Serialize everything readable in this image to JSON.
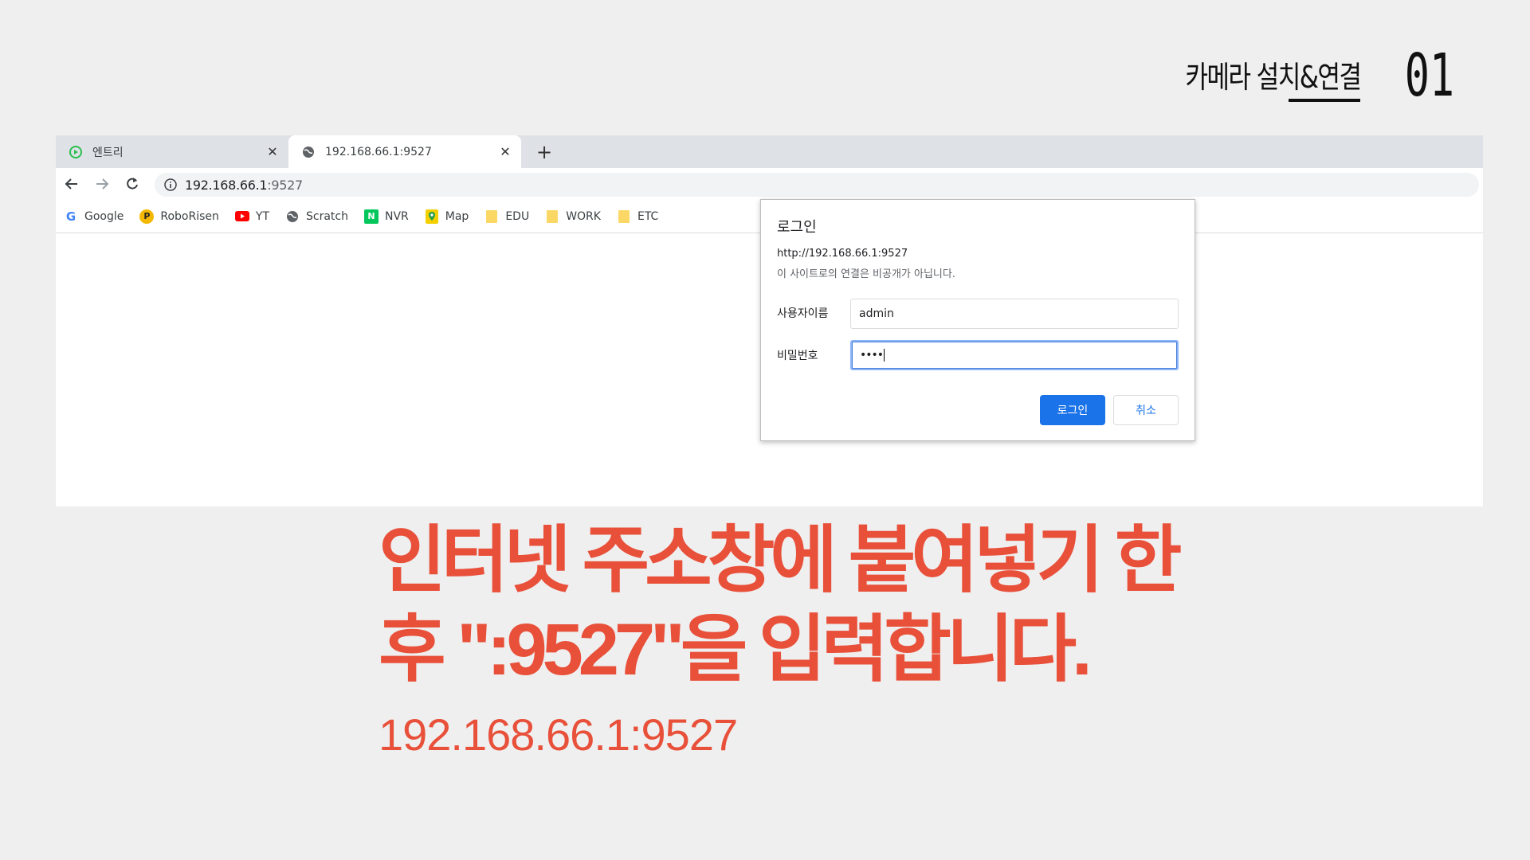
{
  "slide": {
    "heading": "카메라 설치&연결",
    "section_number": "01"
  },
  "browser": {
    "tabs": [
      {
        "title": "엔트리",
        "active": false
      },
      {
        "title": "192.168.66.1:9527",
        "active": true
      }
    ],
    "address": {
      "host": "192.168.66.1",
      "port": ":9527"
    },
    "bookmarks": [
      {
        "label": "Google",
        "icon": "google-icon"
      },
      {
        "label": "RoboRisen",
        "icon": "roborisen-icon"
      },
      {
        "label": "YT",
        "icon": "youtube-icon"
      },
      {
        "label": "Scratch",
        "icon": "globe-icon"
      },
      {
        "label": "NVR",
        "icon": "naver-icon"
      },
      {
        "label": "Map",
        "icon": "map-icon"
      },
      {
        "label": "EDU",
        "icon": "folder-icon"
      },
      {
        "label": "WORK",
        "icon": "folder-icon"
      },
      {
        "label": "ETC",
        "icon": "folder-icon"
      }
    ],
    "colors": {
      "accent": "#1a73e8",
      "tabstrip": "#dee1e6"
    }
  },
  "login_dialog": {
    "title": "로그인",
    "origin": "http://192.168.66.1:9527",
    "warning": "이 사이트로의 연결은 비공개가 아닙니다.",
    "username_label": "사용자이름",
    "username_value": "admin",
    "password_label": "비밀번호",
    "password_value": "••••",
    "login_button": "로그인",
    "cancel_button": "취소"
  },
  "caption": {
    "line1": "인터넷 주소창에 붙여넣기 한",
    "line2": "후 \":9527\"을 입력합니다.",
    "url": "192.168.66.1:9527",
    "color": "#e8503a"
  }
}
